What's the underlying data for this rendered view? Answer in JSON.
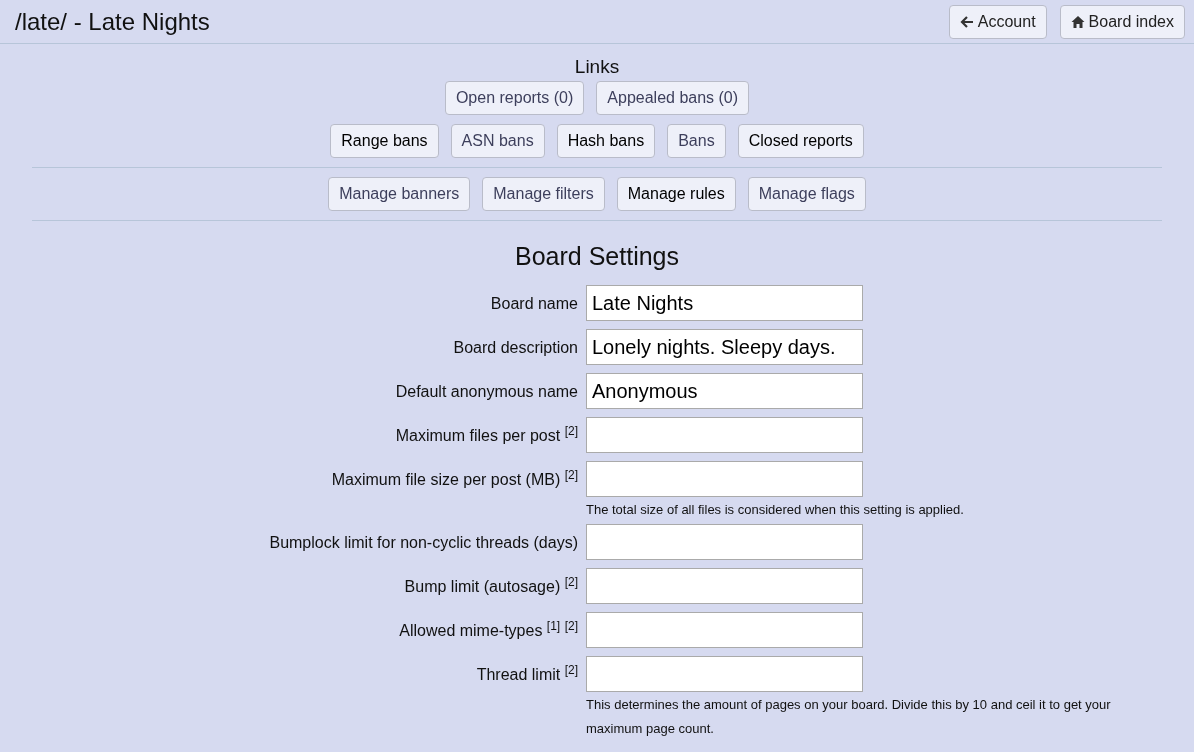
{
  "header": {
    "title": "/late/ - Late Nights",
    "buttons": [
      {
        "label": "Account",
        "kind": "back"
      },
      {
        "label": "Board index",
        "kind": "home"
      }
    ]
  },
  "links": {
    "heading": "Links",
    "groups": [
      {
        "buttons": [
          {
            "label": "Open reports (0)",
            "visited": true
          },
          {
            "label": "Appealed bans (0)",
            "visited": true
          }
        ]
      },
      {
        "buttons": [
          {
            "label": "Range bans",
            "visited": false
          },
          {
            "label": "ASN bans",
            "visited": true
          },
          {
            "label": "Hash bans",
            "visited": false
          },
          {
            "label": "Bans",
            "visited": true
          },
          {
            "label": "Closed reports",
            "visited": false
          }
        ]
      },
      {
        "buttons": [
          {
            "label": "Manage banners",
            "visited": true
          },
          {
            "label": "Manage filters",
            "visited": true
          },
          {
            "label": "Manage rules",
            "visited": false
          },
          {
            "label": "Manage flags",
            "visited": true
          }
        ]
      }
    ]
  },
  "settings": {
    "heading": "Board Settings",
    "fields": [
      {
        "label": "Board name",
        "value": "Late Nights"
      },
      {
        "label": "Board description",
        "value": "Lonely nights. Sleepy days."
      },
      {
        "label": "Default anonymous name",
        "value": "Anonymous"
      },
      {
        "label": "Maximum files per post $^{[2]}$"
      },
      {
        "label": "Maximum file size per post (MB) $^{[2]}$",
        "help": "The total size of all files is considered when this setting is applied."
      },
      {
        "label": "Bumplock limit for non-cyclic threads (days)"
      },
      {
        "label": "Bump limit (autosage) $^{[2]}$"
      },
      {
        "label": "Allowed mime-types $^{[1]}$ $^{[2]}$"
      },
      {
        "label": "Thread limit $^{[2]}$",
        "help": "This determines the amount of pages on your board. Divide this by 10 and ceil it to get your maximum page count."
      }
    ]
  }
}
